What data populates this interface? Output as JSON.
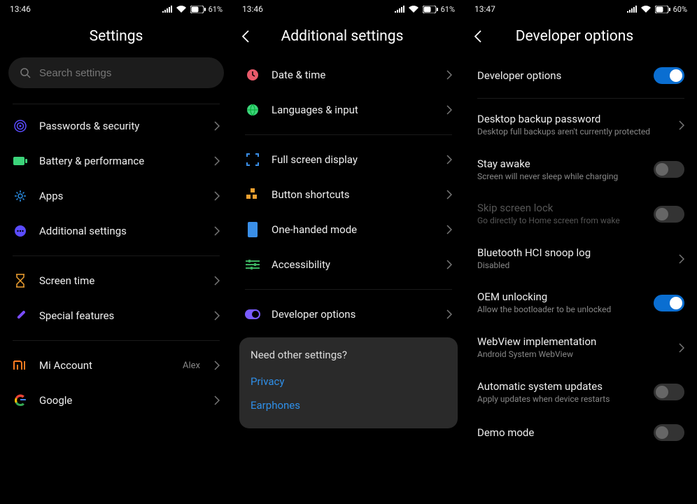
{
  "panel1": {
    "status": {
      "time": "13:46",
      "battery": "61"
    },
    "title": "Settings",
    "search_placeholder": "Search settings",
    "groups": [
      {
        "items": [
          {
            "key": "passwords",
            "label": "Passwords & security"
          },
          {
            "key": "battery",
            "label": "Battery & performance"
          },
          {
            "key": "apps",
            "label": "Apps"
          },
          {
            "key": "additional",
            "label": "Additional settings"
          }
        ]
      },
      {
        "items": [
          {
            "key": "screentime",
            "label": "Screen time"
          },
          {
            "key": "special",
            "label": "Special features"
          }
        ]
      },
      {
        "items": [
          {
            "key": "mi",
            "label": "Mi Account",
            "value": "Alex"
          },
          {
            "key": "google",
            "label": "Google"
          }
        ]
      }
    ]
  },
  "panel2": {
    "status": {
      "time": "13:46",
      "battery": "61"
    },
    "title": "Additional settings",
    "groups": [
      {
        "items": [
          {
            "key": "datetime",
            "label": "Date & time"
          },
          {
            "key": "lang",
            "label": "Languages & input"
          }
        ]
      },
      {
        "items": [
          {
            "key": "fullscreen",
            "label": "Full screen display"
          },
          {
            "key": "buttons",
            "label": "Button shortcuts"
          },
          {
            "key": "onehand",
            "label": "One-handed mode"
          },
          {
            "key": "a11y",
            "label": "Accessibility"
          }
        ]
      },
      {
        "items": [
          {
            "key": "dev",
            "label": "Developer options"
          }
        ]
      }
    ],
    "other": {
      "question": "Need other settings?",
      "links": [
        "Privacy",
        "Earphones"
      ]
    }
  },
  "panel3": {
    "status": {
      "time": "13:47",
      "battery": "60"
    },
    "title": "Developer options",
    "rows": [
      {
        "key": "devopts",
        "title": "Developer options",
        "toggle": true,
        "on": true
      },
      {
        "divider": true
      },
      {
        "key": "backup",
        "title": "Desktop backup password",
        "sub": "Desktop full backups aren't currently protected",
        "chev": true
      },
      {
        "key": "stay",
        "title": "Stay awake",
        "sub": "Screen will never sleep while charging",
        "toggle": true,
        "on": false
      },
      {
        "key": "skip",
        "title": "Skip screen lock",
        "sub": "Go directly to Home screen from wake",
        "toggle": true,
        "on": false,
        "disabled": true
      },
      {
        "key": "hci",
        "title": "Bluetooth HCI snoop log",
        "sub": "Disabled",
        "chev": true
      },
      {
        "key": "oem",
        "title": "OEM unlocking",
        "sub": "Allow the bootloader to be unlocked",
        "toggle": true,
        "on": true
      },
      {
        "key": "webview",
        "title": "WebView implementation",
        "sub": "Android System WebView",
        "chev": true
      },
      {
        "key": "updates",
        "title": "Automatic system updates",
        "sub": "Apply updates when device restarts",
        "toggle": true,
        "on": false
      },
      {
        "key": "demo",
        "title": "Demo mode",
        "toggle": true,
        "on": false
      }
    ]
  }
}
